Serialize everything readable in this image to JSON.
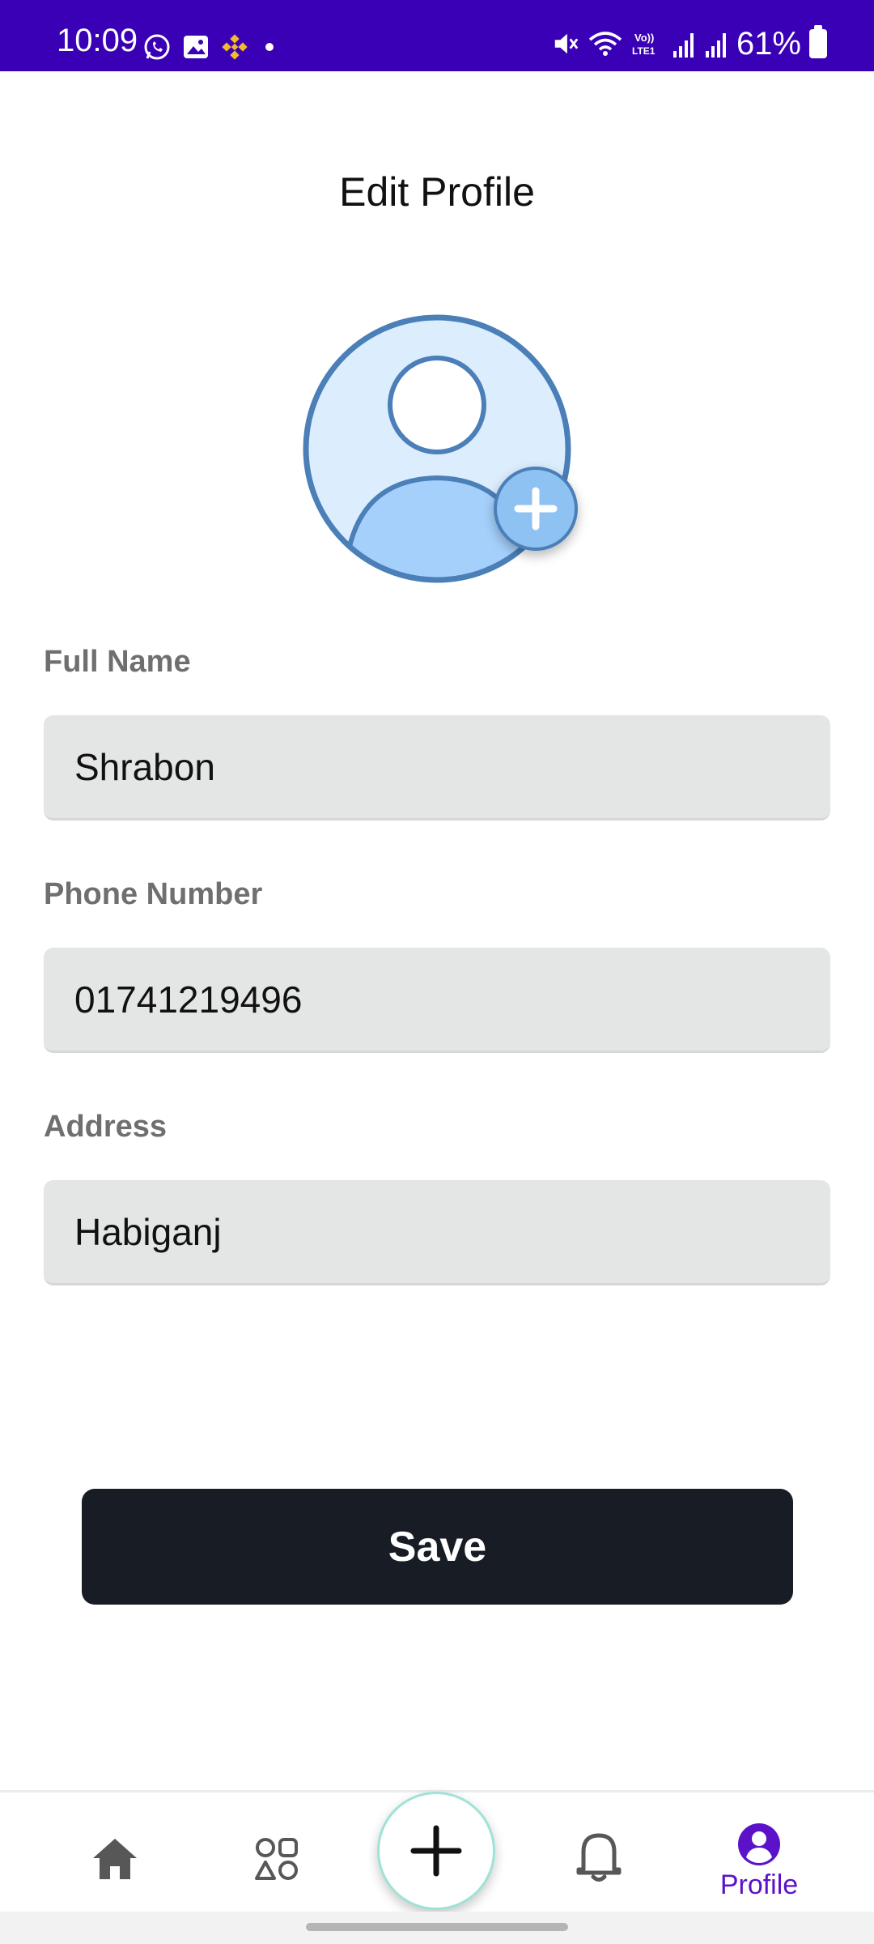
{
  "status_bar": {
    "time": "10:09",
    "battery": "61%",
    "left_icons": [
      "whatsapp-icon",
      "gallery-icon",
      "binance-icon"
    ],
    "right_icons": [
      "mute-icon",
      "wifi-icon",
      "volte-icon",
      "signal-icon",
      "signal-icon"
    ]
  },
  "page": {
    "title": "Edit Profile"
  },
  "avatar": {
    "icon": "user-avatar-icon",
    "add_icon": "plus-icon"
  },
  "form": {
    "full_name": {
      "label": "Full Name",
      "value": "Shrabon"
    },
    "phone": {
      "label": "Phone Number",
      "value": "01741219496"
    },
    "address": {
      "label": "Address",
      "value": "Habiganj"
    }
  },
  "actions": {
    "save_label": "Save"
  },
  "bottom_nav": {
    "items": [
      {
        "icon": "home-icon",
        "label": ""
      },
      {
        "icon": "categories-icon",
        "label": ""
      },
      {
        "icon": "plus-icon",
        "label": ""
      },
      {
        "icon": "bell-icon",
        "label": ""
      },
      {
        "icon": "profile-icon",
        "label": "Profile"
      }
    ],
    "active_color": "#5b12c9"
  },
  "colors": {
    "status_bar": "#3a00b5",
    "save_button": "#181d25",
    "input_background": "#e4e5e5",
    "avatar_fill": "#dcedfd",
    "avatar_stroke": "#4a7fb8"
  }
}
